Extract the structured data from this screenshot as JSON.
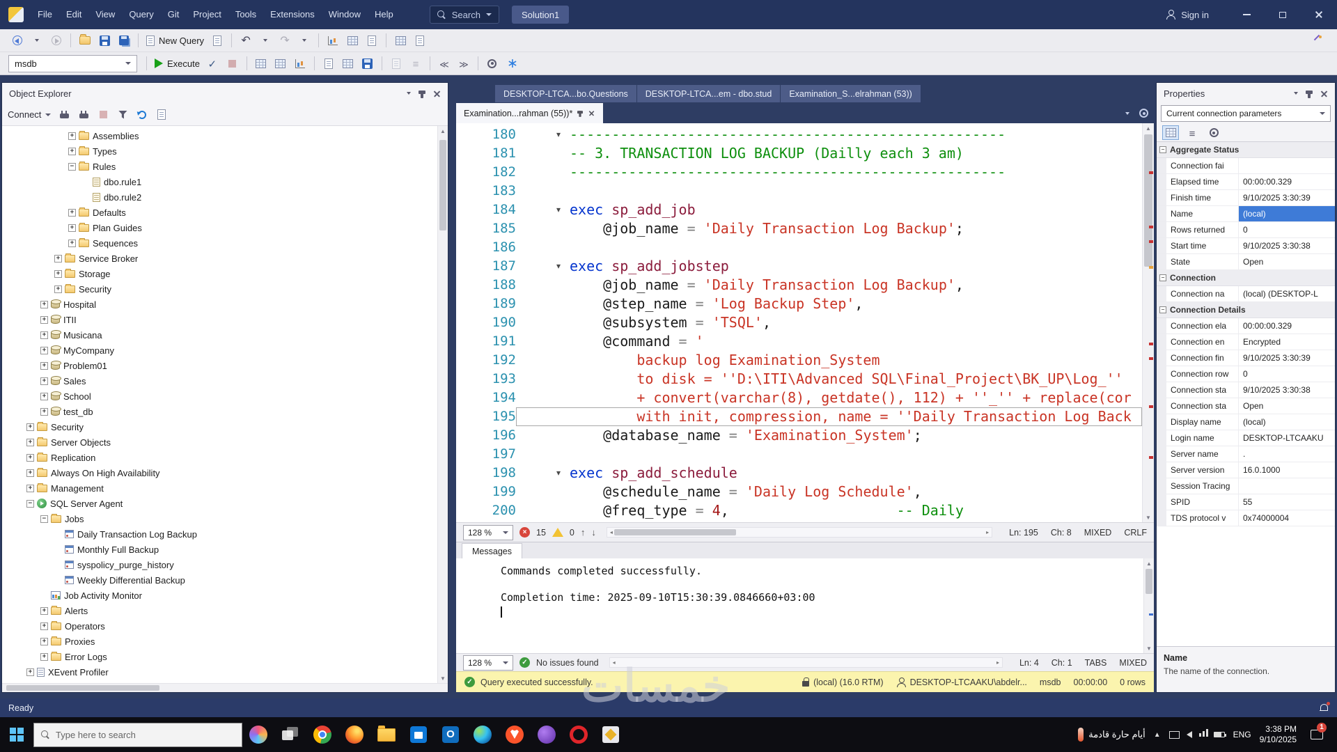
{
  "colors": {
    "titlebar": "#24345E",
    "execute_green": "#18A018",
    "error_red": "#D8463C",
    "warning_yellow": "#F2C233",
    "success_green": "#3E9B3E",
    "status_yellow": "#FBF4AE",
    "ready_blue": "#2B3B69",
    "selection_blue": "#3E7BD7"
  },
  "titlebar": {
    "menus": [
      "File",
      "Edit",
      "View",
      "Query",
      "Git",
      "Project",
      "Tools",
      "Extensions",
      "Window",
      "Help"
    ],
    "search": "Search",
    "solution": "Solution1",
    "sign_in": "Sign in"
  },
  "toolbar_main": {
    "items": [
      {
        "name": "navigate-backward-icon",
        "kind": "navback"
      },
      {
        "name": "navigate-back-dropdown-icon",
        "kind": "chevron"
      },
      {
        "name": "navigate-forward-icon",
        "kind": "navfwd",
        "disabled": true
      },
      {
        "sep": true
      },
      {
        "name": "open-file-icon",
        "kind": "folder"
      },
      {
        "name": "save-icon",
        "kind": "save"
      },
      {
        "name": "save-all-icon",
        "kind": "saveall"
      },
      {
        "sep": true
      },
      {
        "name": "new-query-button",
        "kind": "doc",
        "label": "New Query"
      },
      {
        "name": "new-database-engine-query-icon",
        "kind": "doc"
      },
      {
        "sep": true
      },
      {
        "name": "undo-icon",
        "kind": "undo"
      },
      {
        "name": "undo-dropdown-icon",
        "kind": "chevron"
      },
      {
        "name": "redo-icon",
        "kind": "redo",
        "disabled": true
      },
      {
        "name": "redo-dropdown-icon",
        "kind": "chevron"
      },
      {
        "sep": true
      },
      {
        "name": "activity-monitor-icon",
        "kind": "chart"
      },
      {
        "name": "registered-servers-icon",
        "kind": "grid"
      },
      {
        "name": "template-browser-icon",
        "kind": "doc"
      },
      {
        "sep": true
      },
      {
        "name": "object-explorer-details-icon",
        "kind": "grid"
      },
      {
        "name": "properties-window-icon",
        "kind": "doc"
      }
    ]
  },
  "toolbar_query": {
    "database": "msdb",
    "items": [
      {
        "name": "execute-button",
        "kind": "play",
        "label": "Execute"
      },
      {
        "name": "parse-icon",
        "kind": "check"
      },
      {
        "name": "cancel-query-icon",
        "kind": "stop",
        "disabled": true
      },
      {
        "sep": true
      },
      {
        "name": "display-estimated-plan-icon",
        "kind": "grid"
      },
      {
        "name": "include-actual-plan-icon",
        "kind": "grid"
      },
      {
        "name": "live-query-stats-icon",
        "kind": "chart"
      },
      {
        "sep": true
      },
      {
        "name": "results-to-text-icon",
        "kind": "doc"
      },
      {
        "name": "results-to-grid-icon",
        "kind": "grid"
      },
      {
        "name": "results-to-file-icon",
        "kind": "save"
      },
      {
        "sep": true
      },
      {
        "name": "sqlcmd-mode-icon",
        "kind": "doc",
        "disabled": true
      },
      {
        "name": "comment-selection-icon",
        "kind": "lines",
        "disabled": true
      },
      {
        "sep": true
      },
      {
        "name": "decrease-indent-icon",
        "kind": "outdent"
      },
      {
        "name": "increase-indent-icon",
        "kind": "indent"
      },
      {
        "sep": true
      },
      {
        "name": "query-options-icon",
        "kind": "gear"
      },
      {
        "name": "intellisense-enabled-icon",
        "kind": "spark"
      }
    ]
  },
  "object_explorer": {
    "title": "Object Explorer",
    "connect": "Connect",
    "toolbar_icons": [
      {
        "name": "connect-icon",
        "kind": "plug"
      },
      {
        "name": "disconnect-icon",
        "kind": "plug"
      },
      {
        "name": "stop-icon",
        "kind": "stop",
        "disabled": true
      },
      {
        "name": "filter-icon",
        "kind": "filter"
      },
      {
        "name": "refresh-icon",
        "kind": "refresh"
      },
      {
        "name": "scripting-options-icon",
        "kind": "doc"
      }
    ],
    "tree": [
      {
        "label": "Assemblies",
        "level": 4,
        "expand": "plus",
        "icon": "folder"
      },
      {
        "label": "Types",
        "level": 4,
        "expand": "plus",
        "icon": "folder"
      },
      {
        "label": "Rules",
        "level": 4,
        "expand": "minus",
        "icon": "folder"
      },
      {
        "label": "dbo.rule1",
        "level": 5,
        "expand": "none",
        "icon": "rule"
      },
      {
        "label": "dbo.rule2",
        "level": 5,
        "expand": "none",
        "icon": "rule"
      },
      {
        "label": "Defaults",
        "level": 4,
        "expand": "plus",
        "icon": "folder"
      },
      {
        "label": "Plan Guides",
        "level": 4,
        "expand": "plus",
        "icon": "folder"
      },
      {
        "label": "Sequences",
        "level": 4,
        "expand": "plus",
        "icon": "folder"
      },
      {
        "label": "Service Broker",
        "level": 3,
        "expand": "plus",
        "icon": "folder"
      },
      {
        "label": "Storage",
        "level": 3,
        "expand": "plus",
        "icon": "folder"
      },
      {
        "label": "Security",
        "level": 3,
        "expand": "plus",
        "icon": "folder"
      },
      {
        "label": "Hospital",
        "level": 2,
        "expand": "plus",
        "icon": "db"
      },
      {
        "label": "ITII",
        "level": 2,
        "expand": "plus",
        "icon": "db"
      },
      {
        "label": "Musicana",
        "level": 2,
        "expand": "plus",
        "icon": "db"
      },
      {
        "label": "MyCompany",
        "level": 2,
        "expand": "plus",
        "icon": "db"
      },
      {
        "label": "Problem01",
        "level": 2,
        "expand": "plus",
        "icon": "db"
      },
      {
        "label": "Sales",
        "level": 2,
        "expand": "plus",
        "icon": "db"
      },
      {
        "label": "School",
        "level": 2,
        "expand": "plus",
        "icon": "db"
      },
      {
        "label": "test_db",
        "level": 2,
        "expand": "plus",
        "icon": "db"
      },
      {
        "label": "Security",
        "level": 1,
        "expand": "plus",
        "icon": "folder"
      },
      {
        "label": "Server Objects",
        "level": 1,
        "expand": "plus",
        "icon": "folder"
      },
      {
        "label": "Replication",
        "level": 1,
        "expand": "plus",
        "icon": "folder"
      },
      {
        "label": "Always On High Availability",
        "level": 1,
        "expand": "plus",
        "icon": "folder"
      },
      {
        "label": "Management",
        "level": 1,
        "expand": "plus",
        "icon": "folder"
      },
      {
        "label": "SQL Server Agent",
        "level": 1,
        "expand": "minus",
        "icon": "agent"
      },
      {
        "label": "Jobs",
        "level": 2,
        "expand": "minus",
        "icon": "folder"
      },
      {
        "label": "Daily Transaction Log Backup",
        "level": 3,
        "expand": "none",
        "icon": "job"
      },
      {
        "label": "Monthly Full Backup",
        "level": 3,
        "expand": "none",
        "icon": "job"
      },
      {
        "label": "syspolicy_purge_history",
        "level": 3,
        "expand": "none",
        "icon": "job"
      },
      {
        "label": "Weekly Differential Backup",
        "level": 3,
        "expand": "none",
        "icon": "job"
      },
      {
        "label": "Job Activity Monitor",
        "level": 2,
        "expand": "none",
        "icon": "monitor"
      },
      {
        "label": "Alerts",
        "level": 2,
        "expand": "plus",
        "icon": "folder"
      },
      {
        "label": "Operators",
        "level": 2,
        "expand": "plus",
        "icon": "folder"
      },
      {
        "label": "Proxies",
        "level": 2,
        "expand": "plus",
        "icon": "folder"
      },
      {
        "label": "Error Logs",
        "level": 2,
        "expand": "plus",
        "icon": "folder"
      },
      {
        "label": "XEvent Profiler",
        "level": 1,
        "expand": "plus",
        "icon": "doc"
      }
    ]
  },
  "doc_tabs": {
    "background": [
      "DESKTOP-LTCA...bo.Questions",
      "DESKTOP-LTCA...em - dbo.stud",
      "Examination_S...elrahman (53))"
    ],
    "active": "Examination...rahman (55))*"
  },
  "editor": {
    "lines": [
      {
        "n": 180,
        "fold": true,
        "seg": [
          [
            "cmt",
            "----------------------------------------------------"
          ]
        ]
      },
      {
        "n": 181,
        "seg": [
          [
            "cmt",
            "-- 3. TRANSACTION LOG BACKUP (Dailly each 3 am)"
          ]
        ]
      },
      {
        "n": 182,
        "seg": [
          [
            "cmt",
            "----------------------------------------------------"
          ]
        ]
      },
      {
        "n": 183,
        "seg": []
      },
      {
        "n": 184,
        "fold": true,
        "seg": [
          [
            "kw",
            "exec"
          ],
          [
            "pl",
            " "
          ],
          [
            "proc",
            "sp_add_job"
          ]
        ]
      },
      {
        "n": 185,
        "seg": [
          [
            "pl",
            "    @job_name "
          ],
          [
            "op",
            "="
          ],
          [
            "pl",
            " "
          ],
          [
            "str",
            "'Daily Transaction Log Backup'"
          ],
          [
            "pl",
            ";"
          ]
        ]
      },
      {
        "n": 186,
        "seg": []
      },
      {
        "n": 187,
        "fold": true,
        "seg": [
          [
            "kw",
            "exec"
          ],
          [
            "pl",
            " "
          ],
          [
            "proc",
            "sp_add_jobstep"
          ]
        ]
      },
      {
        "n": 188,
        "seg": [
          [
            "pl",
            "    @job_name "
          ],
          [
            "op",
            "="
          ],
          [
            "pl",
            " "
          ],
          [
            "str",
            "'Daily Transaction Log Backup'"
          ],
          [
            "pl",
            ","
          ]
        ]
      },
      {
        "n": 189,
        "seg": [
          [
            "pl",
            "    @step_name "
          ],
          [
            "op",
            "="
          ],
          [
            "pl",
            " "
          ],
          [
            "str",
            "'Log Backup Step'"
          ],
          [
            "pl",
            ","
          ]
        ]
      },
      {
        "n": 190,
        "seg": [
          [
            "pl",
            "    @subsystem "
          ],
          [
            "op",
            "="
          ],
          [
            "pl",
            " "
          ],
          [
            "str",
            "'TSQL'"
          ],
          [
            "pl",
            ","
          ]
        ]
      },
      {
        "n": 191,
        "seg": [
          [
            "pl",
            "    @command "
          ],
          [
            "op",
            "="
          ],
          [
            "pl",
            " "
          ],
          [
            "str",
            "'"
          ]
        ]
      },
      {
        "n": 192,
        "seg": [
          [
            "str",
            "        backup log Examination_System"
          ]
        ]
      },
      {
        "n": 193,
        "seg": [
          [
            "str",
            "        to disk = ''D:\\ITI\\Advanced SQL\\Final_Project\\BK_UP\\Log_''"
          ]
        ]
      },
      {
        "n": 194,
        "seg": [
          [
            "str",
            "        + convert(varchar(8), getdate(), 112) + ''_'' + replace(cor"
          ]
        ]
      },
      {
        "n": 195,
        "current": true,
        "seg": [
          [
            "str",
            "        with init, compression, name = ''Daily Transaction Log Back"
          ]
        ]
      },
      {
        "n": 196,
        "seg": [
          [
            "pl",
            "    @database_name "
          ],
          [
            "op",
            "="
          ],
          [
            "pl",
            " "
          ],
          [
            "str",
            "'Examination_System'"
          ],
          [
            "pl",
            ";"
          ]
        ]
      },
      {
        "n": 197,
        "seg": []
      },
      {
        "n": 198,
        "fold": true,
        "seg": [
          [
            "kw",
            "exec"
          ],
          [
            "pl",
            " "
          ],
          [
            "proc",
            "sp_add_schedule"
          ]
        ]
      },
      {
        "n": 199,
        "seg": [
          [
            "pl",
            "    @schedule_name "
          ],
          [
            "op",
            "="
          ],
          [
            "pl",
            " "
          ],
          [
            "str",
            "'Daily Log Schedule'"
          ],
          [
            "pl",
            ","
          ]
        ]
      },
      {
        "n": 200,
        "seg": [
          [
            "pl",
            "    @freq_type "
          ],
          [
            "op",
            "="
          ],
          [
            "pl",
            " "
          ],
          [
            "num",
            "4"
          ],
          [
            "pl",
            ",                    "
          ],
          [
            "cmt",
            "-- Daily"
          ]
        ]
      }
    ],
    "scroll_marks": [
      {
        "pos": 0.1,
        "type": "err"
      },
      {
        "pos": 0.25,
        "type": "err"
      },
      {
        "pos": 0.29,
        "type": "err"
      },
      {
        "pos": 0.36,
        "type": "warn"
      },
      {
        "pos": 0.57,
        "type": "err"
      },
      {
        "pos": 0.61,
        "type": "err"
      },
      {
        "pos": 0.74,
        "type": "err"
      },
      {
        "pos": 0.88,
        "type": "err"
      }
    ],
    "status": {
      "zoom": "128 %",
      "errors": "15",
      "warnings": "0",
      "ln": "Ln: 195",
      "ch": "Ch: 8",
      "mixed": "MIXED",
      "eol": "CRLF"
    }
  },
  "messages": {
    "tab": "Messages",
    "lines": [
      "Commands completed successfully.",
      "",
      "Completion time: 2025-09-10T15:30:39.0846660+03:00"
    ],
    "status": {
      "zoom": "128 %",
      "issues": "No issues found",
      "ln": "Ln: 4",
      "ch": "Ch: 1",
      "tabs": "TABS",
      "mixed": "MIXED"
    }
  },
  "query_status": {
    "message": "Query executed successfully.",
    "server": "(local) (16.0 RTM)",
    "user": "DESKTOP-LTCAAKU\\abdelr...",
    "database": "msdb",
    "duration": "00:00:00",
    "rows": "0 rows"
  },
  "properties": {
    "title": "Properties",
    "selector": "Current connection parameters",
    "tools": [
      {
        "name": "categorized-view-icon",
        "kind": "grid",
        "selected": true
      },
      {
        "name": "alphabetical-view-icon",
        "kind": "lines"
      },
      {
        "name": "property-pages-icon",
        "kind": "gear"
      }
    ],
    "grid": [
      {
        "t": "sec",
        "label": "Aggregate Status"
      },
      {
        "t": "row",
        "label": "Connection fai",
        "value": ""
      },
      {
        "t": "row",
        "label": "Elapsed time",
        "value": "00:00:00.329"
      },
      {
        "t": "row",
        "label": "Finish time",
        "value": "9/10/2025 3:30:39"
      },
      {
        "t": "row",
        "label": "Name",
        "value": "(local)",
        "selected": true
      },
      {
        "t": "row",
        "label": "Rows returned",
        "value": "0"
      },
      {
        "t": "row",
        "label": "Start time",
        "value": "9/10/2025 3:30:38"
      },
      {
        "t": "row",
        "label": "State",
        "value": "Open"
      },
      {
        "t": "sec",
        "label": "Connection"
      },
      {
        "t": "row",
        "label": "Connection na",
        "value": "(local) (DESKTOP-L"
      },
      {
        "t": "sec",
        "label": "Connection Details"
      },
      {
        "t": "row",
        "label": "Connection ela",
        "value": "00:00:00.329"
      },
      {
        "t": "row",
        "label": "Connection en",
        "value": "Encrypted"
      },
      {
        "t": "row",
        "label": "Connection fin",
        "value": "9/10/2025 3:30:39"
      },
      {
        "t": "row",
        "label": "Connection row",
        "value": "0"
      },
      {
        "t": "row",
        "label": "Connection sta",
        "value": "9/10/2025 3:30:38"
      },
      {
        "t": "row",
        "label": "Connection sta",
        "value": "Open"
      },
      {
        "t": "row",
        "label": "Display name",
        "value": "(local)"
      },
      {
        "t": "row",
        "label": "Login name",
        "value": "DESKTOP-LTCAAKU"
      },
      {
        "t": "row",
        "label": "Server name",
        "value": "."
      },
      {
        "t": "row",
        "label": "Server version",
        "value": "16.0.1000"
      },
      {
        "t": "row",
        "label": "Session Tracing",
        "value": ""
      },
      {
        "t": "row",
        "label": "SPID",
        "value": "55"
      },
      {
        "t": "row",
        "label": "TDS protocol v",
        "value": "0x74000004"
      }
    ],
    "footer_name": "Name",
    "footer_desc": "The name of the connection."
  },
  "statusbar": {
    "ready": "Ready"
  },
  "taskbar": {
    "search_placeholder": "Type here to search",
    "icons": [
      {
        "name": "copilot-icon",
        "kind": "copilot"
      },
      {
        "name": "task-view-icon",
        "kind": "taskview"
      },
      {
        "name": "chrome-icon",
        "kind": "chrome"
      },
      {
        "name": "firefox-icon",
        "kind": "firefox"
      },
      {
        "name": "file-explorer-icon",
        "kind": "explorer"
      },
      {
        "name": "store-icon",
        "kind": "store"
      },
      {
        "name": "outlook-icon",
        "kind": "outlook"
      },
      {
        "name": "edge-icon",
        "kind": "edge"
      },
      {
        "name": "brave-icon",
        "kind": "brave"
      },
      {
        "name": "media-player-icon",
        "kind": "media"
      },
      {
        "name": "opera-icon",
        "kind": "opera"
      },
      {
        "name": "ssms-icon",
        "kind": "ssms"
      }
    ],
    "weather": "أيام حارة قادمة",
    "tray_icons": [
      {
        "name": "display-icon",
        "kind": "display"
      },
      {
        "name": "volume-icon",
        "kind": "vol"
      },
      {
        "name": "network-icon",
        "kind": "net"
      },
      {
        "name": "battery-icon",
        "kind": "bat"
      }
    ],
    "lang": "ENG",
    "time": "3:38 PM",
    "date": "9/10/2025",
    "badge": "1"
  },
  "watermark": "خمسات"
}
